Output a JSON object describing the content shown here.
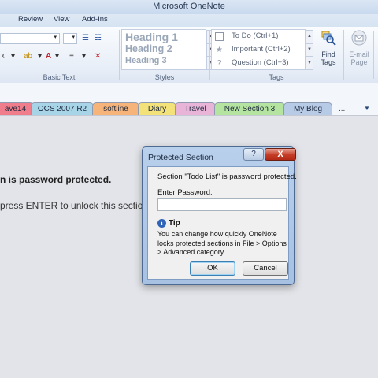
{
  "window": {
    "title": "Microsoft OneNote"
  },
  "ribbon_tabs": [
    "Review",
    "View",
    "Add-Ins"
  ],
  "ribbon": {
    "groups": {
      "basic_text": "Basic Text",
      "styles": "Styles",
      "tags": "Tags"
    },
    "styles": [
      "Heading 1",
      "Heading 2",
      "Heading 3"
    ],
    "tags": [
      {
        "icon": "todo-checkbox-icon",
        "label": "To Do (Ctrl+1)"
      },
      {
        "icon": "star-icon",
        "label": "Important (Ctrl+2)"
      },
      {
        "icon": "question-mark-icon",
        "label": "Question (Ctrl+3)"
      }
    ],
    "find_tags": {
      "line1": "Find",
      "line2": "Tags"
    },
    "email_page": {
      "line1": "E-mail",
      "line2": "Page"
    }
  },
  "section_tabs": [
    {
      "label": "ave14",
      "color": "#f07d8c"
    },
    {
      "label": "OCS 2007 R2",
      "color": "#a8d4e8"
    },
    {
      "label": "softline",
      "color": "#f6b47a"
    },
    {
      "label": "Diary",
      "color": "#f3e27a"
    },
    {
      "label": "Travel",
      "color": "#e8b5d9"
    },
    {
      "label": "New Section 3",
      "color": "#b4e4a0"
    },
    {
      "label": "My Blog",
      "color": "#b8cbe6"
    }
  ],
  "more_tabs": "...",
  "page": {
    "protected_message": "n is password protected.",
    "unlock_message": "press ENTER to unlock this section"
  },
  "dialog": {
    "title": "Protected Section",
    "help_glyph": "?",
    "close_glyph": "X",
    "message": "Section \"Todo List\" is password protected.",
    "password_label": "Enter Password:",
    "password_value": "",
    "tip_title": "Tip",
    "tip_text": "You can change how quickly OneNote locks protected sections in File > Options > Advanced category.",
    "ok_label": "OK",
    "cancel_label": "Cancel"
  }
}
